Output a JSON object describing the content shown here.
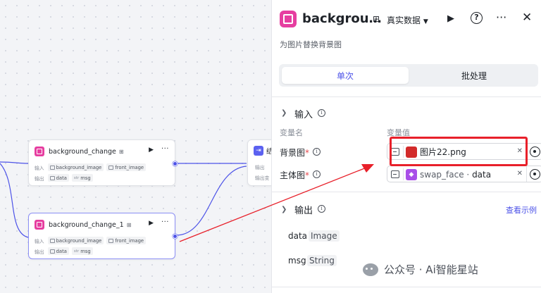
{
  "canvas": {
    "nodes": [
      {
        "title": "background_change",
        "input_label": "输入",
        "inputs": [
          "background_image",
          "front_image"
        ],
        "output_label": "输出",
        "outputs": [
          "data",
          "msg"
        ]
      },
      {
        "title": "background_change_1",
        "input_label": "输入",
        "inputs": [
          "background_image",
          "front_image"
        ],
        "output_label": "输出",
        "outputs": [
          "data",
          "msg"
        ]
      }
    ],
    "end_node": {
      "title_partial": "结",
      "row1": "输出",
      "row2": "输出变"
    }
  },
  "panel": {
    "title": "backgrou…",
    "mode_label": "真实数据",
    "description": "为图片替换背景图",
    "tabs": [
      "单次",
      "批处理"
    ],
    "input_section": {
      "title": "输入",
      "col_name": "变量名",
      "col_value": "变量值",
      "rows": [
        {
          "label": "背景图",
          "value": "图片22.png"
        },
        {
          "label": "主体图",
          "value_source": "swap_face",
          "value_sep": " · ",
          "value_field": "data"
        }
      ]
    },
    "output_section": {
      "title": "输出",
      "example_link": "查看示例",
      "fields": [
        {
          "name": "data",
          "type": "Image"
        },
        {
          "name": "msg",
          "type": "String"
        }
      ]
    }
  },
  "watermark": "公众号 · Ai智能星站",
  "colors": {
    "accent": "#4d53e8",
    "node_icon": "#e63ea0",
    "highlight": "#e8202a"
  }
}
